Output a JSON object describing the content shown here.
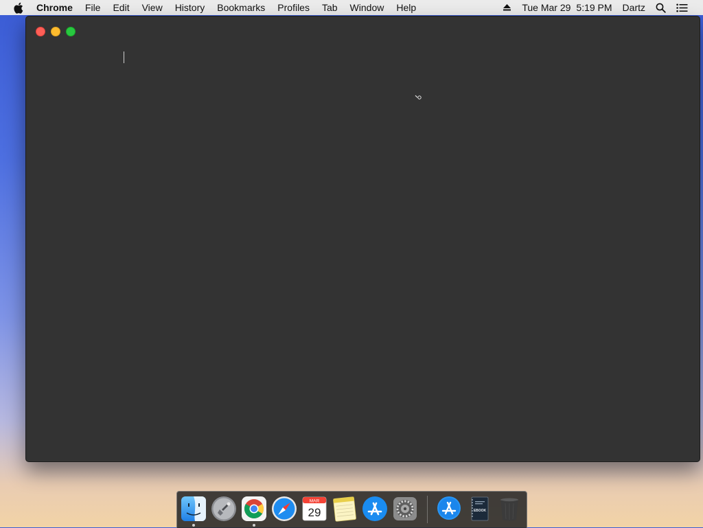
{
  "menubar": {
    "app_name": "Chrome",
    "items": [
      "File",
      "Edit",
      "View",
      "History",
      "Bookmarks",
      "Profiles",
      "Tab",
      "Window",
      "Help"
    ],
    "date": "Tue Mar 29",
    "time": "5:19 PM",
    "user": "Dartz"
  },
  "dock": {
    "items": [
      {
        "name": "Finder",
        "icon": "finder-icon",
        "running": true
      },
      {
        "name": "Launchpad",
        "icon": "launchpad-icon",
        "running": false
      },
      {
        "name": "Google Chrome",
        "icon": "chrome-icon",
        "running": true
      },
      {
        "name": "Safari",
        "icon": "safari-icon",
        "running": false
      },
      {
        "name": "Calendar",
        "icon": "calendar-icon",
        "running": false,
        "month": "MAR",
        "day": "29"
      },
      {
        "name": "Notes",
        "icon": "notes-icon",
        "running": false
      },
      {
        "name": "App Store",
        "icon": "app-store-icon",
        "running": false
      },
      {
        "name": "System Preferences",
        "icon": "system-preferences-icon",
        "running": false
      },
      {
        "name": "App Store Downloads",
        "icon": "app-store-stack-icon",
        "running": false
      },
      {
        "name": "Ebook",
        "icon": "ebook-icon",
        "running": false,
        "label": "EBOOK"
      },
      {
        "name": "Trash",
        "icon": "trash-icon",
        "running": false
      }
    ]
  },
  "colors": {
    "window_bg": "#333333",
    "menubar_bg": "#ebebeb",
    "close": "#fe5f57",
    "minimize": "#febc2e",
    "maximize": "#28c840"
  }
}
